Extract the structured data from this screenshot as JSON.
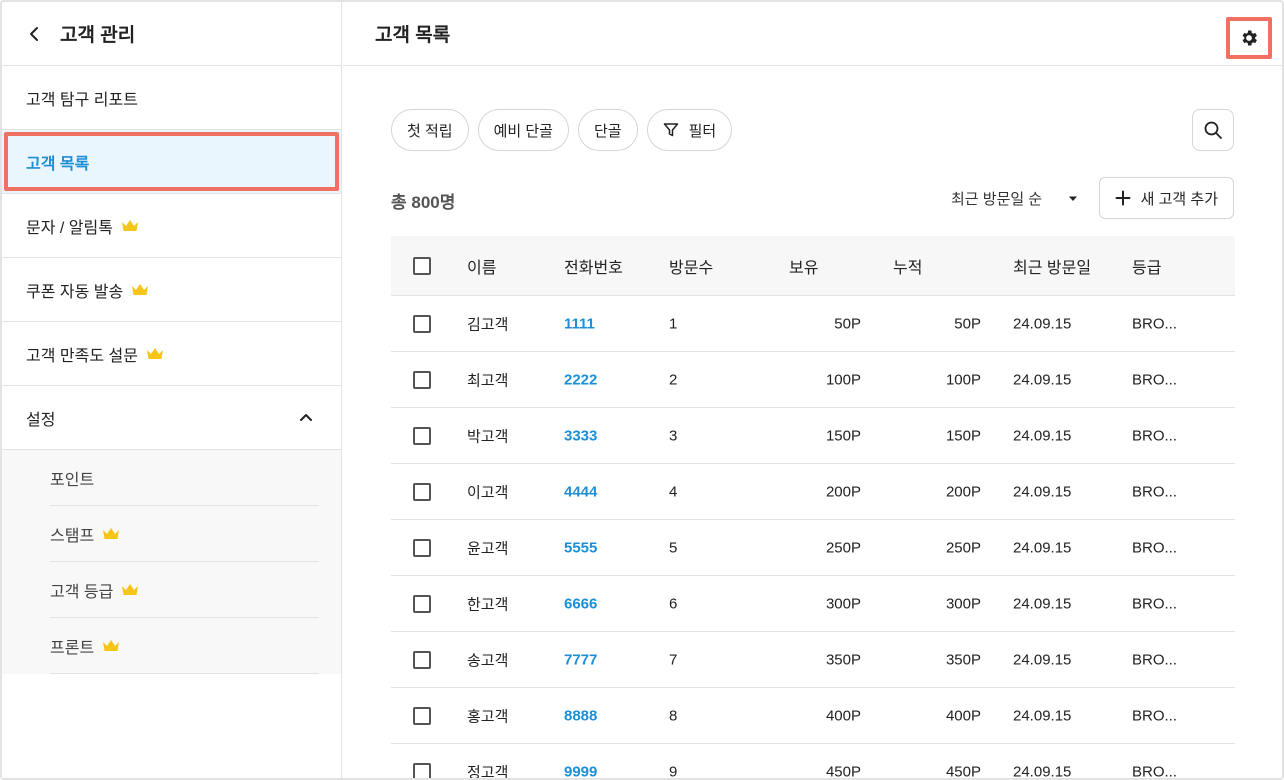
{
  "sidebar": {
    "title": "고객 관리",
    "items": [
      {
        "label": "고객 탐구 리포트",
        "premium": false
      },
      {
        "label": "고객 목록",
        "premium": false,
        "active": true
      },
      {
        "label": "문자 / 알림톡",
        "premium": true
      },
      {
        "label": "쿠폰 자동 발송",
        "premium": true
      },
      {
        "label": "고객 만족도 설문",
        "premium": true
      }
    ],
    "settings": {
      "label": "설정",
      "subitems": [
        {
          "label": "포인트",
          "premium": false
        },
        {
          "label": "스탬프",
          "premium": true
        },
        {
          "label": "고객 등급",
          "premium": true
        },
        {
          "label": "프론트",
          "premium": true
        }
      ]
    }
  },
  "main": {
    "title": "고객 목록",
    "chips": [
      "첫 적립",
      "예비 단골",
      "단골",
      "필터"
    ],
    "count": "총 800명",
    "sort_label": "최근 방문일 순",
    "add_label": "새 고객 추가"
  },
  "table": {
    "headers": [
      "이름",
      "전화번호",
      "방문수",
      "보유",
      "누적",
      "최근 방문일",
      "등급"
    ],
    "rows": [
      {
        "name": "김고객",
        "phone": "1111",
        "visits": "1",
        "hold": "50P",
        "acc": "50P",
        "date": "24.09.15",
        "grade": "BRO..."
      },
      {
        "name": "최고객",
        "phone": "2222",
        "visits": "2",
        "hold": "100P",
        "acc": "100P",
        "date": "24.09.15",
        "grade": "BRO..."
      },
      {
        "name": "박고객",
        "phone": "3333",
        "visits": "3",
        "hold": "150P",
        "acc": "150P",
        "date": "24.09.15",
        "grade": "BRO..."
      },
      {
        "name": "이고객",
        "phone": "4444",
        "visits": "4",
        "hold": "200P",
        "acc": "200P",
        "date": "24.09.15",
        "grade": "BRO..."
      },
      {
        "name": "윤고객",
        "phone": "5555",
        "visits": "5",
        "hold": "250P",
        "acc": "250P",
        "date": "24.09.15",
        "grade": "BRO..."
      },
      {
        "name": "한고객",
        "phone": "6666",
        "visits": "6",
        "hold": "300P",
        "acc": "300P",
        "date": "24.09.15",
        "grade": "BRO..."
      },
      {
        "name": "송고객",
        "phone": "7777",
        "visits": "7",
        "hold": "350P",
        "acc": "350P",
        "date": "24.09.15",
        "grade": "BRO..."
      },
      {
        "name": "홍고객",
        "phone": "8888",
        "visits": "8",
        "hold": "400P",
        "acc": "400P",
        "date": "24.09.15",
        "grade": "BRO..."
      },
      {
        "name": "정고객",
        "phone": "9999",
        "visits": "9",
        "hold": "450P",
        "acc": "450P",
        "date": "24.09.15",
        "grade": "BRO..."
      }
    ]
  },
  "colors": {
    "accent": "#1d8fd6",
    "highlight": "#f07062",
    "crown": "#f5c518",
    "active_bg": "#eaf6fd"
  },
  "icons": [
    "chevron-left-icon",
    "crown-icon",
    "chevron-up-icon",
    "gear-icon",
    "filter-icon",
    "search-icon",
    "caret-down-icon",
    "plus-icon"
  ]
}
